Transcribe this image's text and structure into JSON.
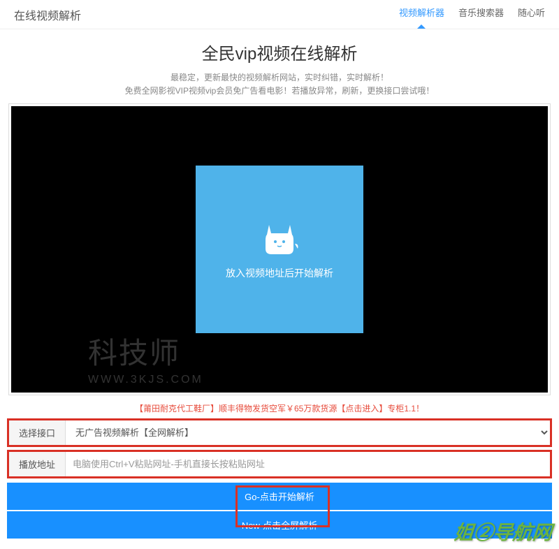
{
  "header": {
    "site_title": "在线视频解析",
    "nav": [
      {
        "label": "视频解析器",
        "active": true
      },
      {
        "label": "音乐搜索器",
        "active": false
      },
      {
        "label": "随心听",
        "active": false
      }
    ]
  },
  "page_title": "全民vip视频在线解析",
  "subtitle_line1": "最稳定，更新最快的视频解析网站，实时纠错，实时解析！",
  "subtitle_line2": "免费全网影视VIP视频vip会员免广告看电影！若播放异常，刷新，更换接口尝试哦！",
  "player": {
    "prompt_text": "放入视频地址后开始解析"
  },
  "watermark": {
    "main": "科技师",
    "sub": "WWW.3KJS.COM"
  },
  "ad_text": "【莆田耐克代工鞋厂】顺丰得物发货空军￥65万款货源【点击进入】专柜1.1！",
  "form": {
    "interface_label": "选择接口",
    "interface_selected": "无广告视频解析【全网解析】",
    "address_label": "播放地址",
    "address_placeholder": "电脑使用Ctrl+V粘贴网址-手机直接长按粘贴网址"
  },
  "buttons": {
    "go_label": "Go-点击开始解析",
    "new_label": "New-点击全屏解析"
  },
  "footer_watermark": "姐②导航网"
}
